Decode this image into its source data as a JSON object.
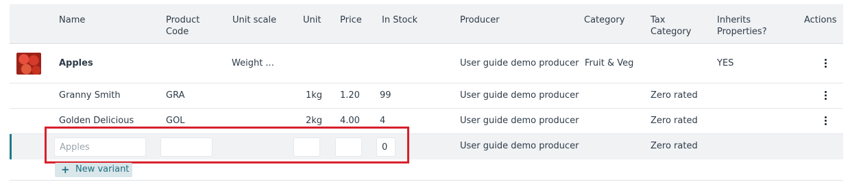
{
  "columns": {
    "name": "Name",
    "product_code": "Product\nCode",
    "unit_scale": "Unit scale",
    "unit": "Unit",
    "price": "Price",
    "in_stock": "In Stock",
    "producer": "Producer",
    "category": "Category",
    "tax_category": "Tax\nCategory",
    "inherits": "Inherits\nProperties?",
    "actions": "Actions"
  },
  "product": {
    "name": "Apples",
    "unit_scale": "Weight ...",
    "producer": "User guide demo producer",
    "category": "Fruit & Veg",
    "inherits": "YES",
    "thumbnail_icon": "apples-thumbnail"
  },
  "variants": [
    {
      "name": "Granny Smith",
      "code": "GRA",
      "unit": "1kg",
      "price": "1.20",
      "stock": "99",
      "producer": "User guide demo producer",
      "tax_category": "Zero rated"
    },
    {
      "name": "Golden Delicious",
      "code": "GOL",
      "unit": "2kg",
      "price": "4.00",
      "stock": "4",
      "producer": "User guide demo producer",
      "tax_category": "Zero rated"
    }
  ],
  "new_variant_row": {
    "name_placeholder": "Apples",
    "stock_value": "0",
    "producer": "User guide demo producer",
    "tax_category": "Zero rated"
  },
  "new_variant_button": {
    "icon": "plus-icon",
    "label": "New variant"
  },
  "colors": {
    "highlight": "#d7202a",
    "accent": "#1e7a8a",
    "header_bg": "#f0f2f4"
  }
}
